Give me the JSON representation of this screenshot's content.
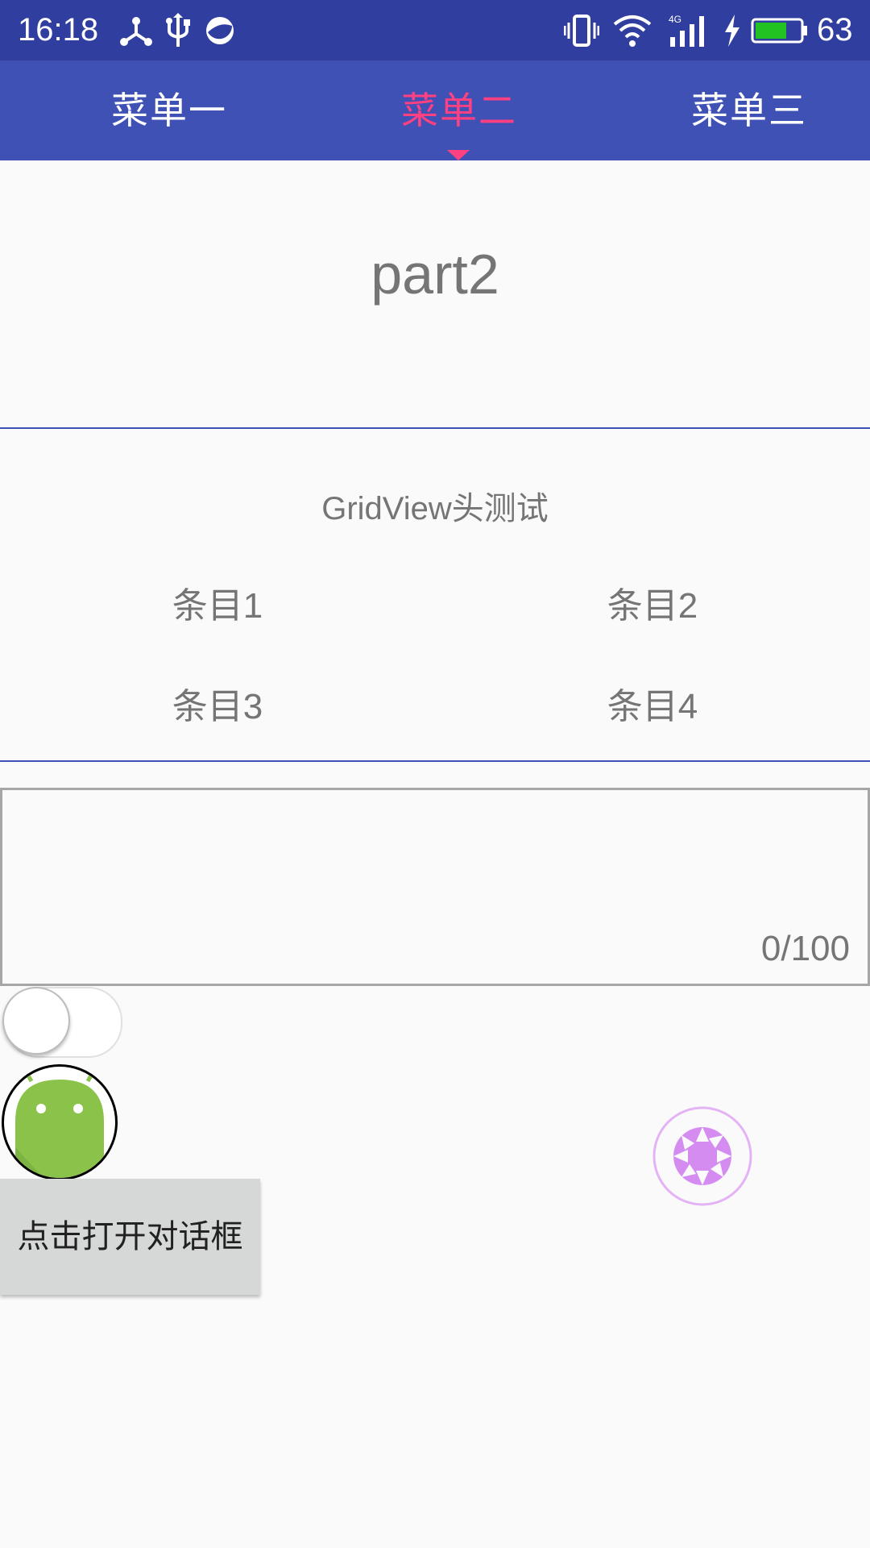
{
  "status_bar": {
    "time": "16:18",
    "battery_level": "63",
    "icons": [
      "nodes-icon",
      "usb-icon",
      "sync-icon",
      "vibrate-icon",
      "wifi-icon",
      "signal-4g-icon",
      "charging-icon",
      "battery-icon"
    ]
  },
  "tabs": [
    {
      "label": "菜单一",
      "active": false
    },
    {
      "label": "菜单二",
      "active": true
    },
    {
      "label": "菜单三",
      "active": false
    }
  ],
  "colors": {
    "status_bar": "#303f9f",
    "tab_bar": "#3f51b5",
    "accent": "#ff4081",
    "button_gray": "#d6d7d7"
  },
  "main": {
    "part_title": "part2",
    "grid_header": "GridView头测试",
    "grid_items": [
      "条目1",
      "条目2",
      "条目3",
      "条目4"
    ],
    "text_counter": "0/100",
    "switch_on": false,
    "dialog_button_label": "点击打开对话框",
    "camera_icon": "aperture-icon",
    "avatar_icon": "android-icon"
  }
}
